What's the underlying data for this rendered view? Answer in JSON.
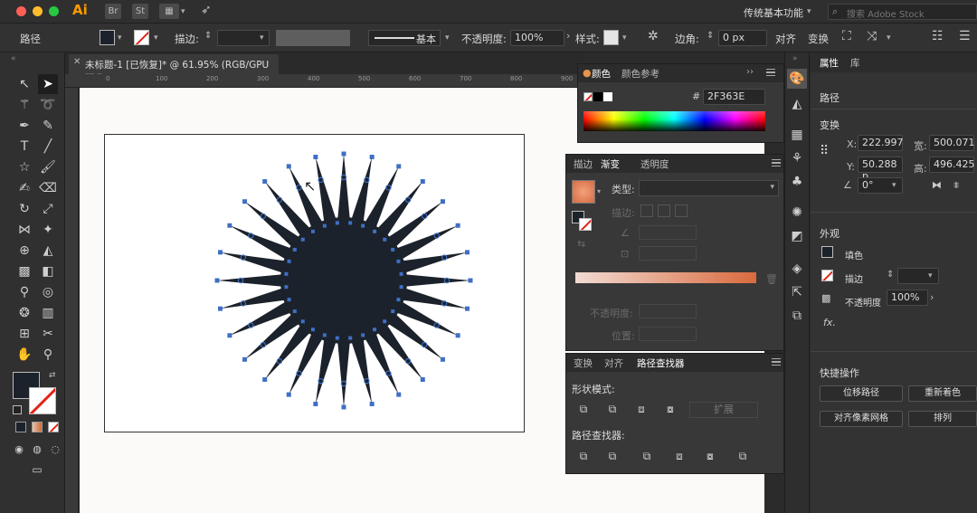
{
  "app": {
    "logo": "Ai",
    "stock_icon": "St",
    "workspace": "传统基本功能",
    "search_placeholder": "搜索 Adobe Stock",
    "colors": {
      "close": "#ff5f57",
      "minimize": "#febc2e",
      "maximize": "#28c840"
    }
  },
  "control_bar": {
    "selection_label": "路径",
    "stroke_label": "描边:",
    "brush_label": "基本",
    "opacity_label": "不透明度:",
    "opacity_value": "100%",
    "style_label": "样式:",
    "corner_label": "边角:",
    "corner_value": "0 px",
    "align_label": "对齐",
    "transform_label": "变换"
  },
  "document": {
    "tab_title": "未标题-1 [已恢复]* @ 61.95% (RGB/GPU 预览)",
    "ruler_ticks": [
      "0",
      "100",
      "200",
      "300",
      "400",
      "500",
      "600",
      "700",
      "800",
      "900",
      "1000"
    ]
  },
  "color_panel": {
    "tabs": [
      "颜色",
      "颜色参考"
    ],
    "hex_label": "#",
    "hex_value": "2F363E"
  },
  "gradient_panel": {
    "tabs": [
      "描边",
      "渐变",
      "透明度"
    ],
    "type_label": "类型:",
    "stroke_label": "描边:",
    "opacity_label": "不透明度:",
    "position_label": "位置:"
  },
  "pathfinder_panel": {
    "tabs": [
      "变换",
      "对齐",
      "路径查找器"
    ],
    "shape_modes_label": "形状模式:",
    "expand_label": "扩展",
    "pathfinders_label": "路径查找器:"
  },
  "properties_panel": {
    "tabs": [
      "属性",
      "库"
    ],
    "section_path": "路径",
    "section_transform": "变换",
    "x_label": "X:",
    "x_value": "222.997",
    "y_label": "Y:",
    "y_value": "50.288 p",
    "w_label": "宽:",
    "w_value": "500.071",
    "h_label": "高:",
    "h_value": "496.425",
    "angle_value": "0°",
    "section_appearance": "外观",
    "fill_label": "填色",
    "stroke_label": "描边",
    "opacity_label": "不透明度",
    "opacity_value": "100%",
    "fx_label": "fx.",
    "section_quick": "快捷操作",
    "quick_buttons": [
      "位移路径",
      "重新着色",
      "对齐像素网格",
      "排列"
    ]
  },
  "starburst": {
    "points": 28,
    "fill_color": "#1c222b",
    "anchor_color": "#3f6fc4"
  }
}
